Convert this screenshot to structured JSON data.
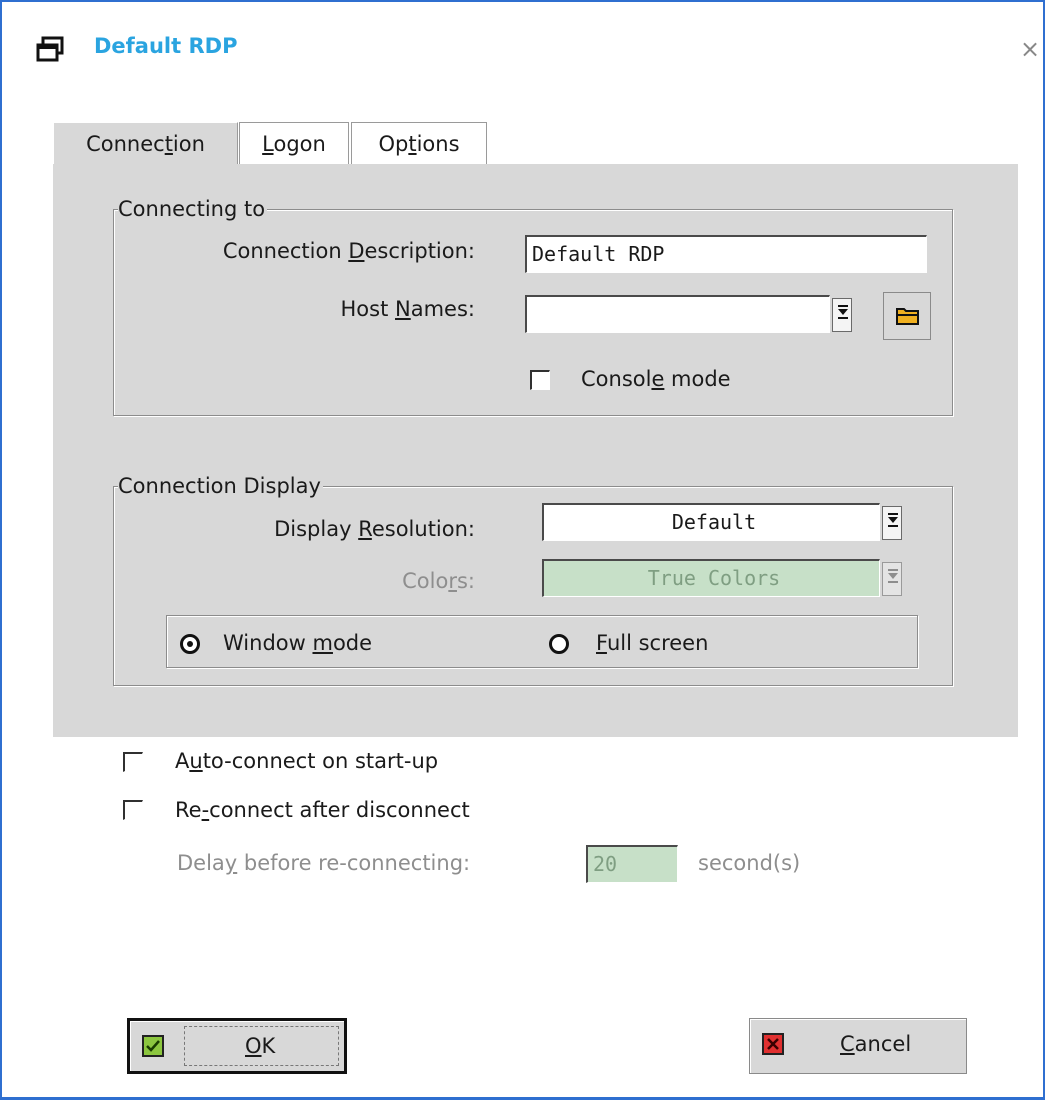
{
  "window": {
    "title": "Default RDP",
    "close_glyph": "×"
  },
  "tabs": [
    {
      "pre": "Connec",
      "mn": "t",
      "post": "ion",
      "active": true
    },
    {
      "pre": "",
      "mn": "L",
      "post": "ogon",
      "active": false
    },
    {
      "pre": "Op",
      "mn": "t",
      "post": "ions",
      "active": false
    }
  ],
  "connecting_to": {
    "legend": "Connecting to",
    "description_label": {
      "pre": "Connection ",
      "mn": "D",
      "post": "escription:"
    },
    "description_value": "Default RDP",
    "host_label": {
      "pre": "Host ",
      "mn": "N",
      "post": "ames:"
    },
    "host_value": "",
    "console_label": {
      "pre": "Consol",
      "mn": "e",
      "post": " mode"
    },
    "console_checked": false
  },
  "display": {
    "legend": "Connection Display",
    "resolution_label": {
      "pre": "Display ",
      "mn": "R",
      "post": "esolution:"
    },
    "resolution_value": "Default",
    "colors_label": {
      "pre": "Colo",
      "mn": "r",
      "post": "s:"
    },
    "colors_value": "True Colors",
    "window_mode_label": {
      "pre": "Window ",
      "mn": "m",
      "post": "ode"
    },
    "full_screen_label": {
      "pre": "",
      "mn": "F",
      "post": "ull screen"
    },
    "selected_mode": "window"
  },
  "options": {
    "auto_connect_label": {
      "pre": "A",
      "mn": "u",
      "post": "to-connect on start-up"
    },
    "auto_connect_checked": false,
    "reconnect_label": {
      "pre": "Re",
      "mn": "-",
      "post": "connect after disconnect"
    },
    "reconnect_checked": false,
    "delay_label": {
      "pre": "Dela",
      "mn": "y",
      "post": " before re-connecting:"
    },
    "delay_value": "20",
    "delay_unit": "second(s)"
  },
  "buttons": {
    "ok": {
      "pre": "",
      "mn": "O",
      "post": "K"
    },
    "cancel": {
      "pre": "",
      "mn": "C",
      "post": "ancel"
    }
  },
  "colors": {
    "title": "#2aa4e0",
    "window_border": "#2f6fd0",
    "panel": "#d8d8d8",
    "disabled_field": "#c7e0c8"
  }
}
